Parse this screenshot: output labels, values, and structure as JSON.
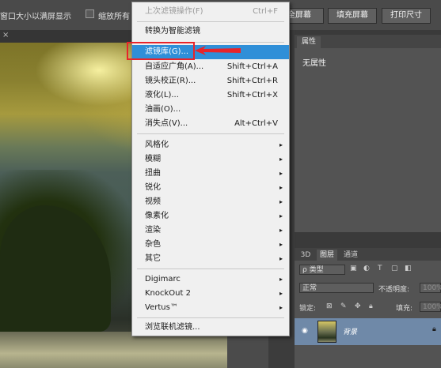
{
  "optionsbar": {
    "fit_label": "窗口大小以满屏显示",
    "zoom_label": "缩放所有",
    "btn_fill": "填充屏幕",
    "btn_fillscreen_suffix": "全屏幕",
    "btn_print": "打印尺寸"
  },
  "doc": {
    "close_x": "×"
  },
  "properties": {
    "tab": "属性",
    "empty": "无属性"
  },
  "layers": {
    "tabs": [
      "3D",
      "图层",
      "通道"
    ],
    "filter_kind": "ρ 类型",
    "blend_mode": "正常",
    "opacity_label": "不透明度:",
    "opacity_value": "100%",
    "lock_label": "锁定:",
    "fill_label": "填充:",
    "fill_value": "100%",
    "layer_name": "背景"
  },
  "menu": {
    "items": [
      {
        "label": "上次滤镜操作(F)",
        "shortcut": "Ctrl+F"
      },
      {
        "label": "转换为智能滤镜",
        "shortcut": ""
      },
      {
        "label": "滤镜库(G)...",
        "shortcut": ""
      },
      {
        "label": "自适应广角(A)...",
        "shortcut": "Shift+Ctrl+A"
      },
      {
        "label": "镜头校正(R)...",
        "shortcut": "Shift+Ctrl+R"
      },
      {
        "label": "液化(L)...",
        "shortcut": "Shift+Ctrl+X"
      },
      {
        "label": "油画(O)...",
        "shortcut": ""
      },
      {
        "label": "消失点(V)...",
        "shortcut": "Alt+Ctrl+V"
      },
      {
        "label": "风格化",
        "shortcut": ""
      },
      {
        "label": "模糊",
        "shortcut": ""
      },
      {
        "label": "扭曲",
        "shortcut": ""
      },
      {
        "label": "锐化",
        "shortcut": ""
      },
      {
        "label": "视频",
        "shortcut": ""
      },
      {
        "label": "像素化",
        "shortcut": ""
      },
      {
        "label": "渲染",
        "shortcut": ""
      },
      {
        "label": "杂色",
        "shortcut": ""
      },
      {
        "label": "其它",
        "shortcut": ""
      },
      {
        "label": "Digimarc",
        "shortcut": ""
      },
      {
        "label": "KnockOut 2",
        "shortcut": ""
      },
      {
        "label": "Vertus™",
        "shortcut": ""
      },
      {
        "label": "浏览联机滤镜...",
        "shortcut": ""
      }
    ],
    "submenu_arrow": "▸",
    "highlight_color": "#2f8fd8",
    "annotation_color": "#e8242a"
  }
}
